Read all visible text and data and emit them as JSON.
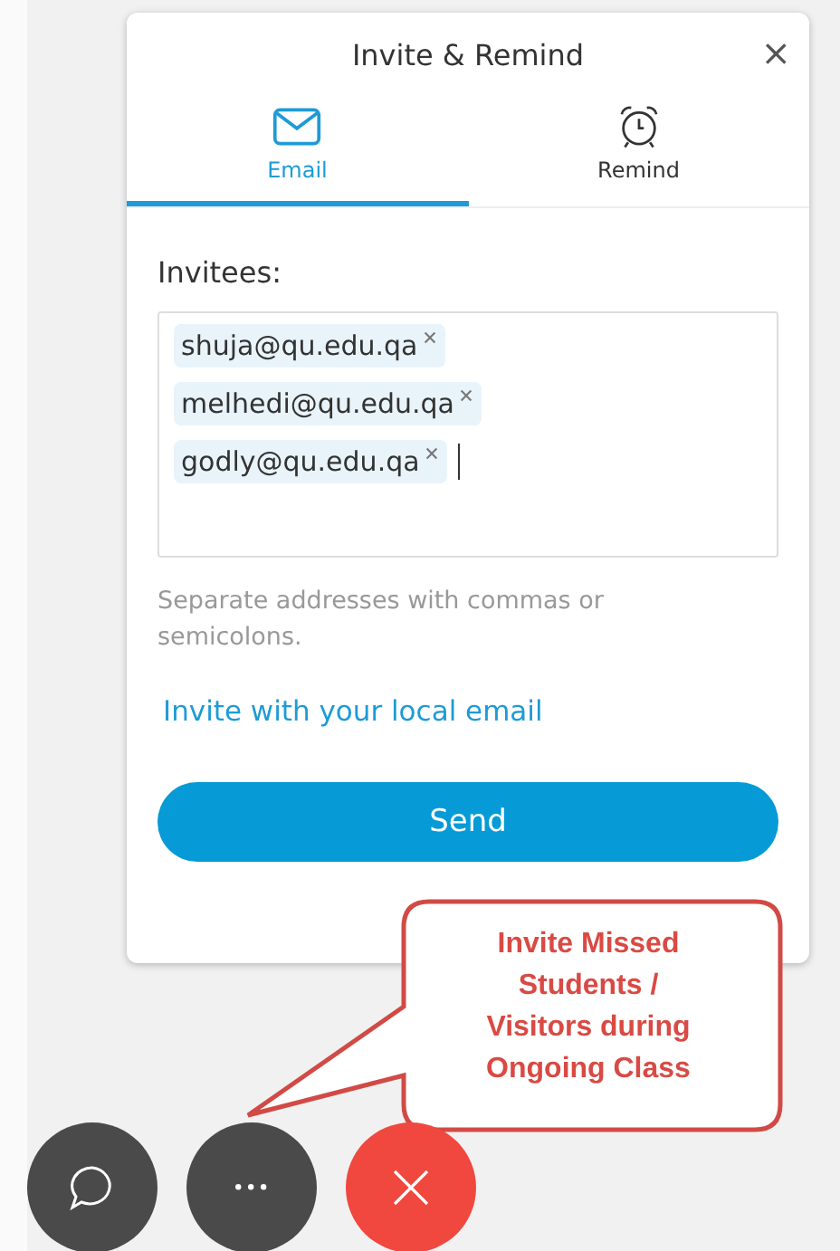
{
  "dialog": {
    "title": "Invite & Remind",
    "close": "×"
  },
  "tabs": [
    {
      "label": "Email",
      "kind": "email",
      "selected": true
    },
    {
      "label": "Remind",
      "kind": "remind",
      "selected": false
    }
  ],
  "invitees": {
    "label": "Invitees:",
    "emails": [
      "shuja@qu.edu.qa",
      "melhedi@qu.edu.qa",
      "godly@qu.edu.qa"
    ],
    "hint": "Separate addresses with commas or semicolons."
  },
  "local_email_link": "Invite with your local email",
  "send_button": "Send",
  "callout": "Invite Missed\nStudents /\nVisitors during\nOngoing Class",
  "toolbar": [
    {
      "kind": "chat"
    },
    {
      "kind": "more"
    },
    {
      "kind": "end"
    }
  ]
}
